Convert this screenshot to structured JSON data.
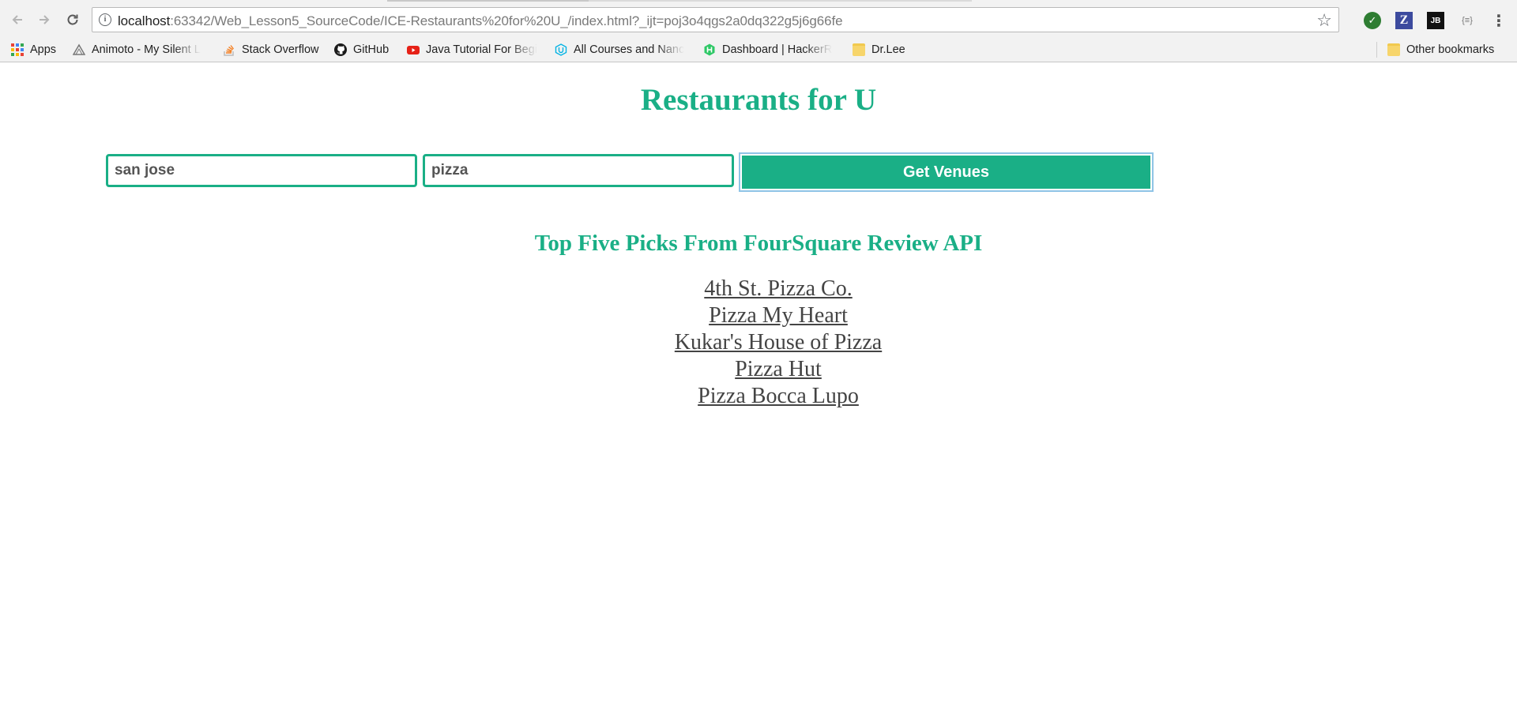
{
  "browser": {
    "url_host": "localhost",
    "url_rest": ":63342/Web_Lesson5_SourceCode/ICE-Restaurants%20for%20U_/index.html?_ijt=poj3o4qgs2a0dq322g5j6g66fe",
    "bookmarks": [
      {
        "label": "Apps",
        "icon": "apps-grid-icon"
      },
      {
        "label": "Animoto - My Silent L",
        "icon": "animoto-icon"
      },
      {
        "label": "Stack Overflow",
        "icon": "stackoverflow-icon"
      },
      {
        "label": "GitHub",
        "icon": "github-icon"
      },
      {
        "label": "Java Tutorial For Begi",
        "icon": "youtube-icon"
      },
      {
        "label": "All Courses and Nanc",
        "icon": "udacity-icon"
      },
      {
        "label": "Dashboard | HackerR",
        "icon": "hackerrank-icon"
      },
      {
        "label": "Dr.Lee",
        "icon": "folder-icon"
      }
    ],
    "other_bookmarks": "Other bookmarks",
    "extensions": {
      "z": "Z",
      "jb": "JB",
      "brace": "{≡}"
    }
  },
  "page": {
    "title": "Restaurants for U",
    "location_input": {
      "value": "san jose"
    },
    "query_input": {
      "value": "pizza"
    },
    "get_venues_label": "Get Venues",
    "subtitle": "Top Five Picks From FourSquare Review API",
    "results": [
      "4th St. Pizza Co.",
      "Pizza My Heart",
      "Kukar's House of Pizza",
      "Pizza Hut",
      "Pizza Bocca Lupo"
    ]
  },
  "colors": {
    "accent": "#1aaf86",
    "link": "#444444",
    "input_text": "#555555",
    "chrome_bg": "#f2f2f2"
  }
}
